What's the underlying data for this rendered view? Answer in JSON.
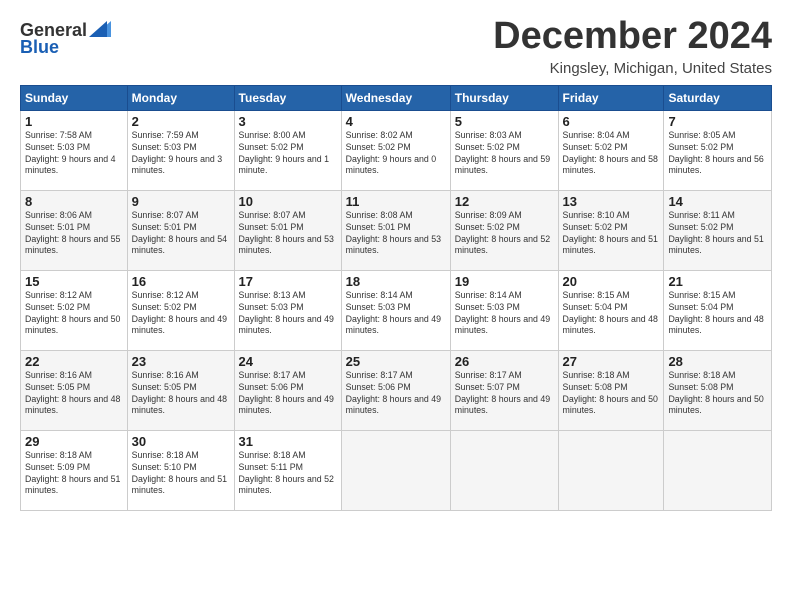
{
  "header": {
    "logo": {
      "line1": "General",
      "line2": "Blue"
    },
    "title": "December 2024",
    "location": "Kingsley, Michigan, United States"
  },
  "calendar": {
    "days_of_week": [
      "Sunday",
      "Monday",
      "Tuesday",
      "Wednesday",
      "Thursday",
      "Friday",
      "Saturday"
    ],
    "weeks": [
      [
        null,
        null,
        null,
        null,
        null,
        null,
        null
      ]
    ],
    "cells": [
      {
        "day": "1",
        "sunrise": "7:58 AM",
        "sunset": "5:03 PM",
        "daylight": "9 hours and 4 minutes."
      },
      {
        "day": "2",
        "sunrise": "7:59 AM",
        "sunset": "5:03 PM",
        "daylight": "9 hours and 3 minutes."
      },
      {
        "day": "3",
        "sunrise": "8:00 AM",
        "sunset": "5:02 PM",
        "daylight": "9 hours and 1 minute."
      },
      {
        "day": "4",
        "sunrise": "8:02 AM",
        "sunset": "5:02 PM",
        "daylight": "9 hours and 0 minutes."
      },
      {
        "day": "5",
        "sunrise": "8:03 AM",
        "sunset": "5:02 PM",
        "daylight": "8 hours and 59 minutes."
      },
      {
        "day": "6",
        "sunrise": "8:04 AM",
        "sunset": "5:02 PM",
        "daylight": "8 hours and 58 minutes."
      },
      {
        "day": "7",
        "sunrise": "8:05 AM",
        "sunset": "5:02 PM",
        "daylight": "8 hours and 56 minutes."
      },
      {
        "day": "8",
        "sunrise": "8:06 AM",
        "sunset": "5:01 PM",
        "daylight": "8 hours and 55 minutes."
      },
      {
        "day": "9",
        "sunrise": "8:07 AM",
        "sunset": "5:01 PM",
        "daylight": "8 hours and 54 minutes."
      },
      {
        "day": "10",
        "sunrise": "8:07 AM",
        "sunset": "5:01 PM",
        "daylight": "8 hours and 53 minutes."
      },
      {
        "day": "11",
        "sunrise": "8:08 AM",
        "sunset": "5:01 PM",
        "daylight": "8 hours and 53 minutes."
      },
      {
        "day": "12",
        "sunrise": "8:09 AM",
        "sunset": "5:02 PM",
        "daylight": "8 hours and 52 minutes."
      },
      {
        "day": "13",
        "sunrise": "8:10 AM",
        "sunset": "5:02 PM",
        "daylight": "8 hours and 51 minutes."
      },
      {
        "day": "14",
        "sunrise": "8:11 AM",
        "sunset": "5:02 PM",
        "daylight": "8 hours and 51 minutes."
      },
      {
        "day": "15",
        "sunrise": "8:12 AM",
        "sunset": "5:02 PM",
        "daylight": "8 hours and 50 minutes."
      },
      {
        "day": "16",
        "sunrise": "8:12 AM",
        "sunset": "5:02 PM",
        "daylight": "8 hours and 49 minutes."
      },
      {
        "day": "17",
        "sunrise": "8:13 AM",
        "sunset": "5:03 PM",
        "daylight": "8 hours and 49 minutes."
      },
      {
        "day": "18",
        "sunrise": "8:14 AM",
        "sunset": "5:03 PM",
        "daylight": "8 hours and 49 minutes."
      },
      {
        "day": "19",
        "sunrise": "8:14 AM",
        "sunset": "5:03 PM",
        "daylight": "8 hours and 49 minutes."
      },
      {
        "day": "20",
        "sunrise": "8:15 AM",
        "sunset": "5:04 PM",
        "daylight": "8 hours and 48 minutes."
      },
      {
        "day": "21",
        "sunrise": "8:15 AM",
        "sunset": "5:04 PM",
        "daylight": "8 hours and 48 minutes."
      },
      {
        "day": "22",
        "sunrise": "8:16 AM",
        "sunset": "5:05 PM",
        "daylight": "8 hours and 48 minutes."
      },
      {
        "day": "23",
        "sunrise": "8:16 AM",
        "sunset": "5:05 PM",
        "daylight": "8 hours and 48 minutes."
      },
      {
        "day": "24",
        "sunrise": "8:17 AM",
        "sunset": "5:06 PM",
        "daylight": "8 hours and 49 minutes."
      },
      {
        "day": "25",
        "sunrise": "8:17 AM",
        "sunset": "5:06 PM",
        "daylight": "8 hours and 49 minutes."
      },
      {
        "day": "26",
        "sunrise": "8:17 AM",
        "sunset": "5:07 PM",
        "daylight": "8 hours and 49 minutes."
      },
      {
        "day": "27",
        "sunrise": "8:18 AM",
        "sunset": "5:08 PM",
        "daylight": "8 hours and 50 minutes."
      },
      {
        "day": "28",
        "sunrise": "8:18 AM",
        "sunset": "5:08 PM",
        "daylight": "8 hours and 50 minutes."
      },
      {
        "day": "29",
        "sunrise": "8:18 AM",
        "sunset": "5:09 PM",
        "daylight": "8 hours and 51 minutes."
      },
      {
        "day": "30",
        "sunrise": "8:18 AM",
        "sunset": "5:10 PM",
        "daylight": "8 hours and 51 minutes."
      },
      {
        "day": "31",
        "sunrise": "8:18 AM",
        "sunset": "5:11 PM",
        "daylight": "8 hours and 52 minutes."
      }
    ]
  }
}
